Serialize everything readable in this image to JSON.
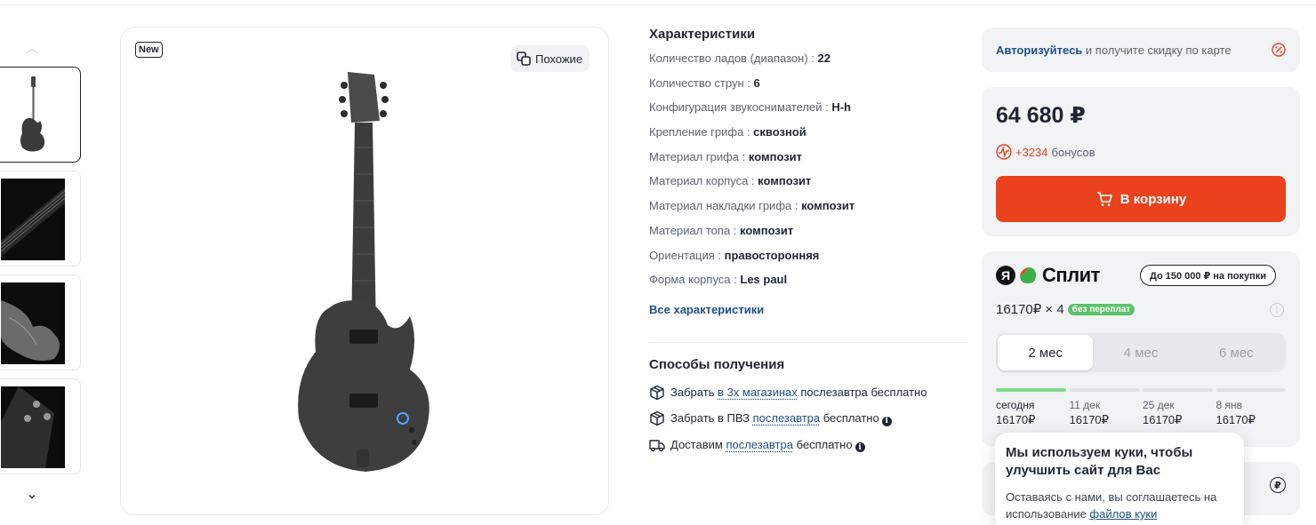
{
  "product": {
    "badge": "New",
    "similar_label": "Похожие"
  },
  "thumbnails": {
    "count": 4
  },
  "specs": {
    "title": "Характеристики",
    "items": [
      {
        "label": "Количество ладов (диапазон) : ",
        "value": "22"
      },
      {
        "label": "Количество струн : ",
        "value": "6"
      },
      {
        "label": "Конфигурация звукоснимателей : ",
        "value": "H-h"
      },
      {
        "label": "Крепление грифа : ",
        "value": "сквозной"
      },
      {
        "label": "Материал грифа : ",
        "value": "композит"
      },
      {
        "label": "Материал корпуса : ",
        "value": "композит"
      },
      {
        "label": "Материал накладки грифа : ",
        "value": "композит"
      },
      {
        "label": "Материал топа : ",
        "value": "композит"
      },
      {
        "label": "Ориентация : ",
        "value": "правосторонняя"
      },
      {
        "label": "Форма корпуса : ",
        "value": "Les paul"
      }
    ],
    "all_link": "Все характеристики"
  },
  "delivery": {
    "title": "Способы получения",
    "rows": [
      {
        "pre": "Забрать ",
        "link": "в 3х магазинах",
        "post": " послезавтра бесплатно",
        "info": false,
        "icon": "box-icon"
      },
      {
        "pre": "Забрать в ПВЗ ",
        "link": "послезавтра",
        "post": " бесплатно",
        "info": true,
        "icon": "box-icon"
      },
      {
        "pre": "Доставим ",
        "link": "послезавтра",
        "post": " бесплатно",
        "info": true,
        "icon": "truck-icon"
      }
    ]
  },
  "auth": {
    "link": "Авторизуйтесь",
    "text": " и получите скидку по карте"
  },
  "price": {
    "value": "64 680 ₽",
    "bonus_value": "+3234",
    "bonus_text": "бонусов",
    "cart_label": "В корзину"
  },
  "split": {
    "brand_letter": "Я",
    "name": "Сплит",
    "limit": "До 150 000 ₽ на покупки",
    "payment": "16170₽ × 4",
    "no_overpay": "без переплат",
    "months": [
      {
        "label": "2 мес",
        "active": true
      },
      {
        "label": "4 мес",
        "active": false
      },
      {
        "label": "6 мес",
        "active": false
      }
    ],
    "schedule": [
      {
        "date": "сегодня",
        "amount": "16170₽",
        "done": true
      },
      {
        "date": "11 дек",
        "amount": "16170₽",
        "done": false
      },
      {
        "date": "25 дек",
        "amount": "16170₽",
        "done": false
      },
      {
        "date": "8 янв",
        "amount": "16170₽",
        "done": false
      }
    ]
  },
  "cookie": {
    "title": "Мы используем куки, чтобы улучшить сайт для Вас",
    "text": "Оставаясь с нами, вы соглашаетесь на использование ",
    "link": "файлов куки"
  },
  "colors": {
    "accent": "#e9421c",
    "link": "#204f86",
    "panel": "#f2f3f5",
    "success": "#5bc26a"
  }
}
